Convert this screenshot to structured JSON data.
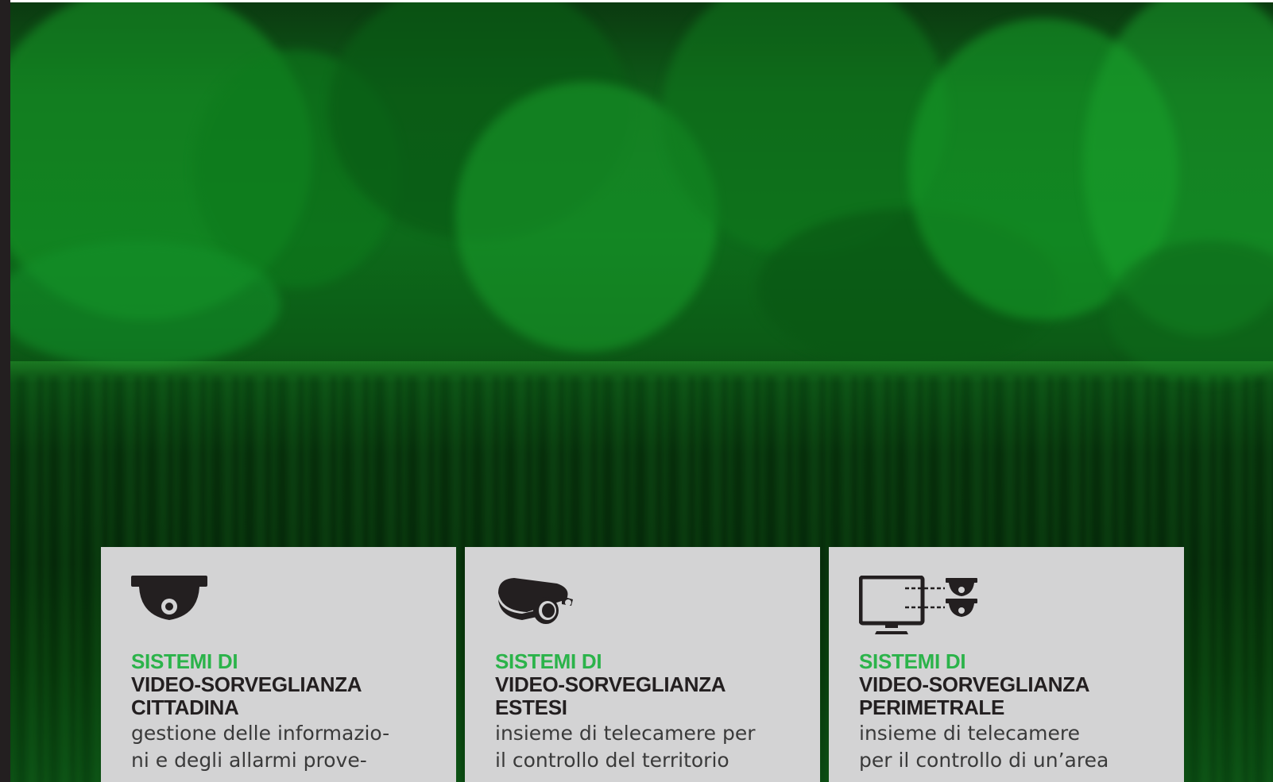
{
  "colors": {
    "accent_green": "#2bb34a",
    "card_background": "#d3d3d4",
    "heading_dark": "#231f20",
    "hero_tint": "#0d6a1a"
  },
  "hero": {
    "image": "forest-lake-photo"
  },
  "cards": [
    {
      "icon": "dome-camera-icon",
      "title_line1": "SISTEMI DI",
      "title_line2": "VIDEO-SORVEGLIANZA",
      "title_line3": "CITTADINA",
      "desc_line1": "gestione delle informazio-",
      "desc_line2": "ni e degli allarmi prove-"
    },
    {
      "icon": "bullet-camera-icon",
      "title_line1": "SISTEMI DI",
      "title_line2": "VIDEO-SORVEGLIANZA",
      "title_line3": "ESTESI",
      "desc_line1": "insieme di telecamere per",
      "desc_line2": "il controllo del territorio"
    },
    {
      "icon": "monitor-cameras-icon",
      "title_line1": "SISTEMI DI",
      "title_line2": "VIDEO-SORVEGLIANZA",
      "title_line3": "PERIMETRALE",
      "desc_line1": "insieme di telecamere",
      "desc_line2": "per il controllo di un’area"
    }
  ]
}
